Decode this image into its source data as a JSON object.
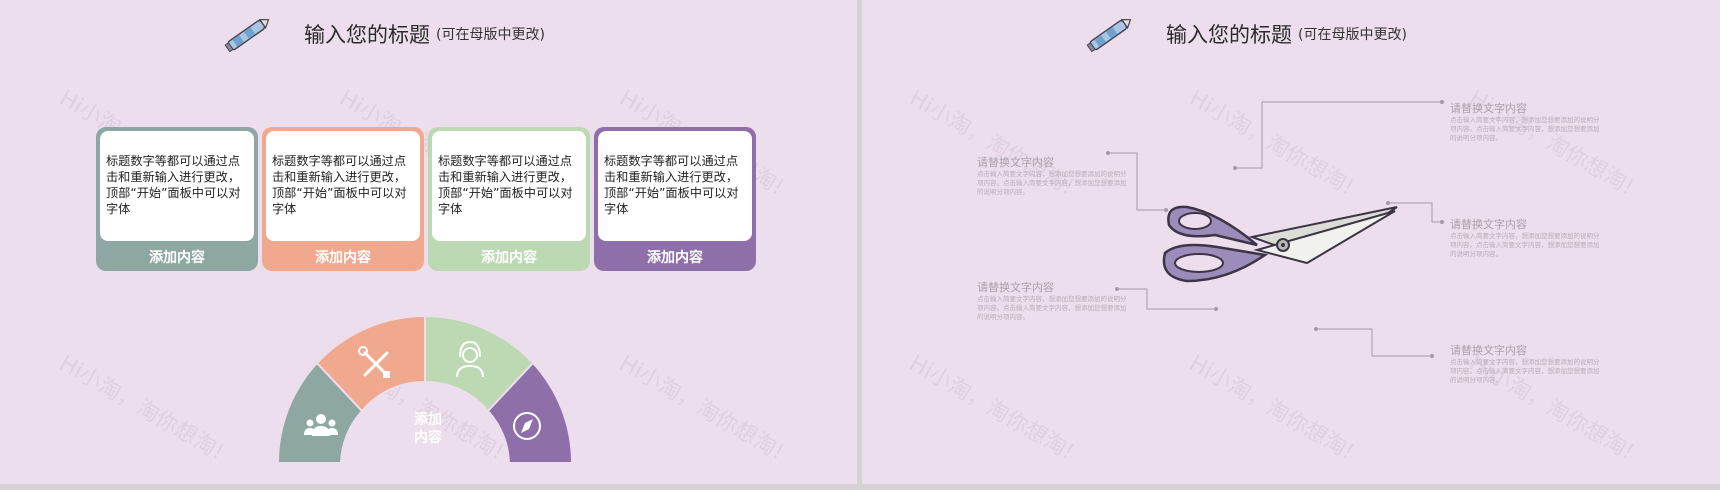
{
  "left_slide": {
    "title": "输入您的标题",
    "subtitle": "(可在母版中更改)",
    "cards": [
      {
        "text": "标题数字等都可以通过点击和重新输入进行更改，顶部“开始”面板中可以对字体",
        "label": "添加内容",
        "color": "#8ea7a3"
      },
      {
        "text": "标题数字等都可以通过点击和重新输入进行更改，顶部“开始”面板中可以对字体",
        "label": "添加内容",
        "color": "#f0a98e"
      },
      {
        "text": "标题数字等都可以通过点击和重新输入进行更改，顶部“开始”面板中可以对字体",
        "label": "添加内容",
        "color": "#bdd9b3"
      },
      {
        "text": "标题数字等都可以通过点击和重新输入进行更改，顶部“开始”面板中可以对字体",
        "label": "添加内容",
        "color": "#8f6fa9"
      }
    ],
    "semicircle": {
      "center_line1": "添加",
      "center_line2": "内容",
      "segments": [
        {
          "icon": "users-icon",
          "color": "#8ea7a3"
        },
        {
          "icon": "tools-icon",
          "color": "#f0a98e"
        },
        {
          "icon": "headset-person-icon",
          "color": "#bdd9b3"
        },
        {
          "icon": "compass-icon",
          "color": "#8f6fa9"
        }
      ]
    }
  },
  "right_slide": {
    "title": "输入您的标题",
    "subtitle": "(可在母版中更改)",
    "callouts": [
      {
        "title": "请替换文字内容",
        "body": "点击输入简要文字内容，想添加您想要添加的说明分项内容。点击输入简要文字内容，想添加您想要添加的说明分项内容。"
      },
      {
        "title": "请替换文字内容",
        "body": "点击输入简要文字内容，想添加您想要添加的说明分项内容。点击输入简要文字内容，想添加您想要添加的说明分项内容。"
      },
      {
        "title": "请替换文字内容",
        "body": "点击输入简要文字内容，想添加您想要添加的说明分项内容。点击输入简要文字内容，想添加您想要添加的说明分项内容。"
      },
      {
        "title": "请替换文字内容",
        "body": "点击输入简要文字内容，想添加您想要添加的说明分项内容。点击输入简要文字内容，想添加您想要添加的说明分项内容。"
      },
      {
        "title": "请替换文字内容",
        "body": "点击输入简要文字内容，想添加您想要添加的说明分项内容。点击输入简要文字内容，想添加您想要添加的说明分项内容。"
      }
    ]
  },
  "watermark_text": "Hi小淘，淘你想淘!"
}
